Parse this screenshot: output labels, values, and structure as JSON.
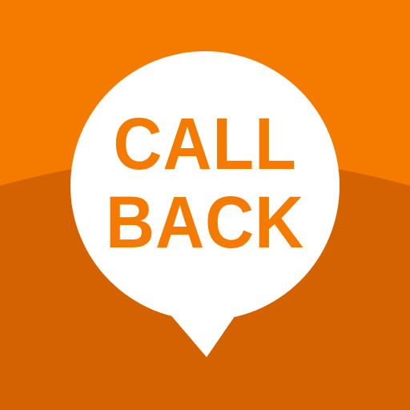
{
  "app_icon": {
    "line1": "CALL",
    "line2": "BACK",
    "colors": {
      "top_orange": "#f47a00",
      "bottom_orange": "#d46200",
      "bubble": "#ffffff",
      "text": "#f47a00"
    },
    "icon_name": "speech-bubble-icon"
  }
}
